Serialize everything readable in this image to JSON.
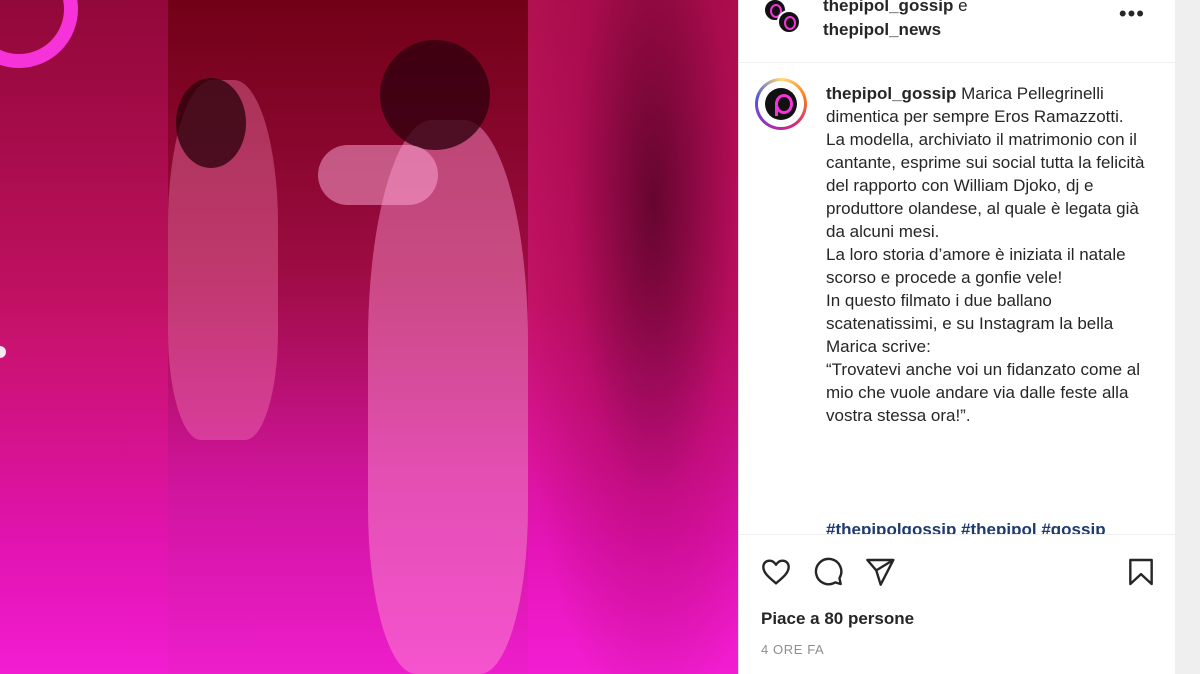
{
  "post": {
    "header": {
      "author_primary": "thepipol_gossip",
      "conjunction": "e",
      "author_secondary": "thepipol_news"
    },
    "caption": {
      "username": "thepipol_gossip",
      "lines": [
        "Marica Pellegrinelli dimentica per sempre Eros Ramazzotti.",
        "La modella, archiviato il matrimonio con il cantante, esprime sui social tutta la felicità del rapporto con William Djoko, dj e produttore olandese, al quale è legata già da alcuni mesi.",
        "La loro storia d’amore è iniziata il natale scorso e procede a gonfie vele!",
        "In questo filmato i due ballano scatenatissimi, e su Instagram la bella Marica scrive:",
        "“Trovatevi anche voi un fidanzato come al mio che vuole andare via dalle feste alla vostra stessa ora!”."
      ],
      "hashtags": "#thepipolgossip #thepipol #gossip"
    },
    "likes": "Piace a 80 persone",
    "timestamp": "4 ORE FA"
  },
  "icons": {
    "more": "more-options-icon",
    "like": "heart-icon",
    "comment": "comment-icon",
    "share": "send-icon",
    "save": "bookmark-icon"
  },
  "colors": {
    "accent_pink": "#f533d8",
    "text": "#262626",
    "muted": "#8e8e8e",
    "hashtag": "#1e3a6e"
  }
}
